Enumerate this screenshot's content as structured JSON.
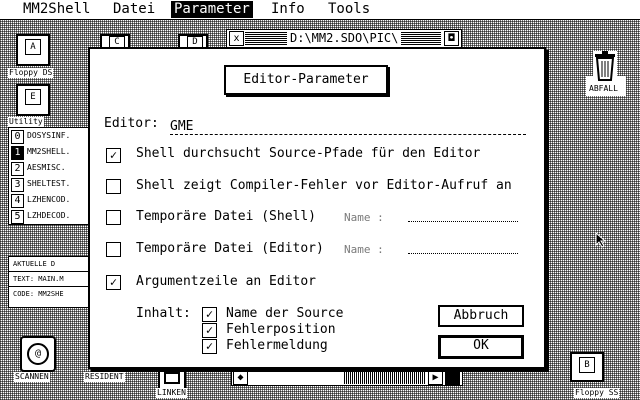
{
  "menubar": {
    "items": [
      "MM2Shell",
      "Datei",
      "Parameter",
      "Info",
      "Tools"
    ],
    "selected": "Parameter"
  },
  "desktop": {
    "floppy_a": {
      "letter": "A",
      "label": "Floppy DS"
    },
    "floppy_c": {
      "letter": "C"
    },
    "floppy_d": {
      "letter": "D"
    },
    "utility": {
      "letter": "E",
      "label": "Utility"
    },
    "trash": {
      "label": "ABFALL"
    },
    "floppy_b": {
      "letter": "B",
      "label": "Floppy SS"
    },
    "scan": {
      "label": "SCANNEN"
    },
    "resident": {
      "label": "RESIDENT"
    },
    "linken": {
      "label": "LINKEN"
    }
  },
  "file_list": [
    {
      "num": "0",
      "name": "DOSYSINF."
    },
    {
      "num": "1",
      "name": "MM2SHELL."
    },
    {
      "num": "2",
      "name": "AESMISC."
    },
    {
      "num": "3",
      "name": "SHELTEST."
    },
    {
      "num": "4",
      "name": "LZHENCOD."
    },
    {
      "num": "5",
      "name": "LZHDECOD."
    }
  ],
  "info_box": {
    "line1": "AKTUELLE D",
    "line2": "TEXT: MAIN.M",
    "line3": "CODE: MM2SHE"
  },
  "window": {
    "path": "D:\\MM2.SDO\\PIC\\"
  },
  "dialog": {
    "title": "Editor-Parameter",
    "editor_label": "Editor:",
    "editor_value": "GME",
    "opt1": {
      "label": "Shell durchsucht Source-Pfade für den Editor",
      "checked": true
    },
    "opt2": {
      "label": "Shell zeigt Compiler-Fehler vor Editor-Aufruf an",
      "checked": false
    },
    "opt3": {
      "label": "Temporäre Datei (Shell)",
      "checked": false,
      "name_label": "Name  :"
    },
    "opt4": {
      "label": "Temporäre Datei (Editor)",
      "checked": false,
      "name_label": "Name  :"
    },
    "opt5": {
      "label": "Argumentzeile an Editor",
      "checked": true
    },
    "inhalt_label": "Inhalt:",
    "inhalt": [
      {
        "label": "Name der Source",
        "checked": true
      },
      {
        "label": "Fehlerposition",
        "checked": true
      },
      {
        "label": "Fehlermeldung",
        "checked": true
      }
    ],
    "cancel_label": "Abbruch",
    "ok_label": "OK"
  },
  "glyphs": {
    "check": "✓",
    "close": "x",
    "full": "◘",
    "left": "◆",
    "right": "▶"
  }
}
